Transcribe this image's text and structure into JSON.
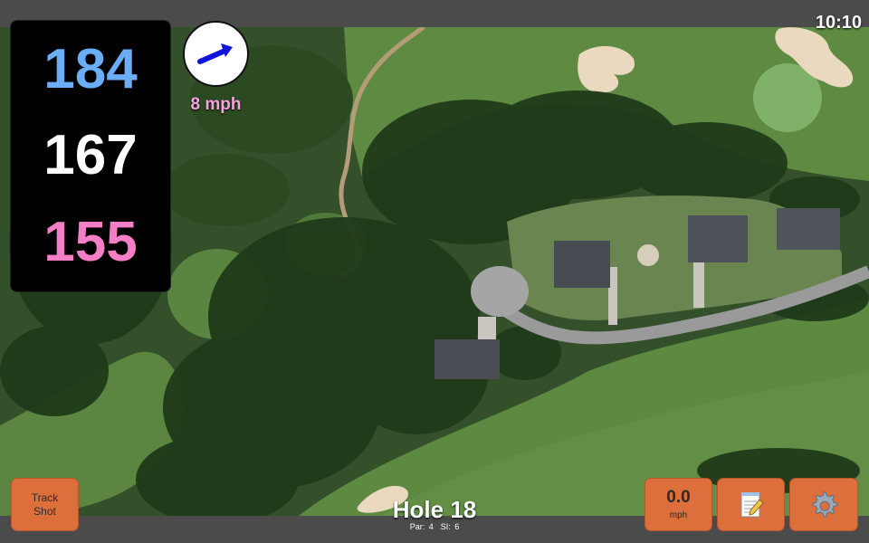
{
  "clock": {
    "time": "10:10"
  },
  "distances": {
    "back": "184",
    "middle": "167",
    "front": "155"
  },
  "wind": {
    "speed": "8 mph",
    "direction_icon": "wind-arrow-icon"
  },
  "track_shot": {
    "line1": "Track",
    "line2": "Shot"
  },
  "hole": {
    "title": "Hole 18",
    "par": "Par: 4",
    "si": "SI: 6"
  },
  "speed": {
    "value": "0.0",
    "unit": "mph"
  },
  "icons": {
    "notes": "notepad-icon",
    "settings": "gear-icon"
  },
  "colors": {
    "back": "#6aaef7",
    "middle": "#ffffff",
    "front": "#f57fc6",
    "wind_text": "#f7a3e0",
    "button": "#dd6f3d"
  }
}
